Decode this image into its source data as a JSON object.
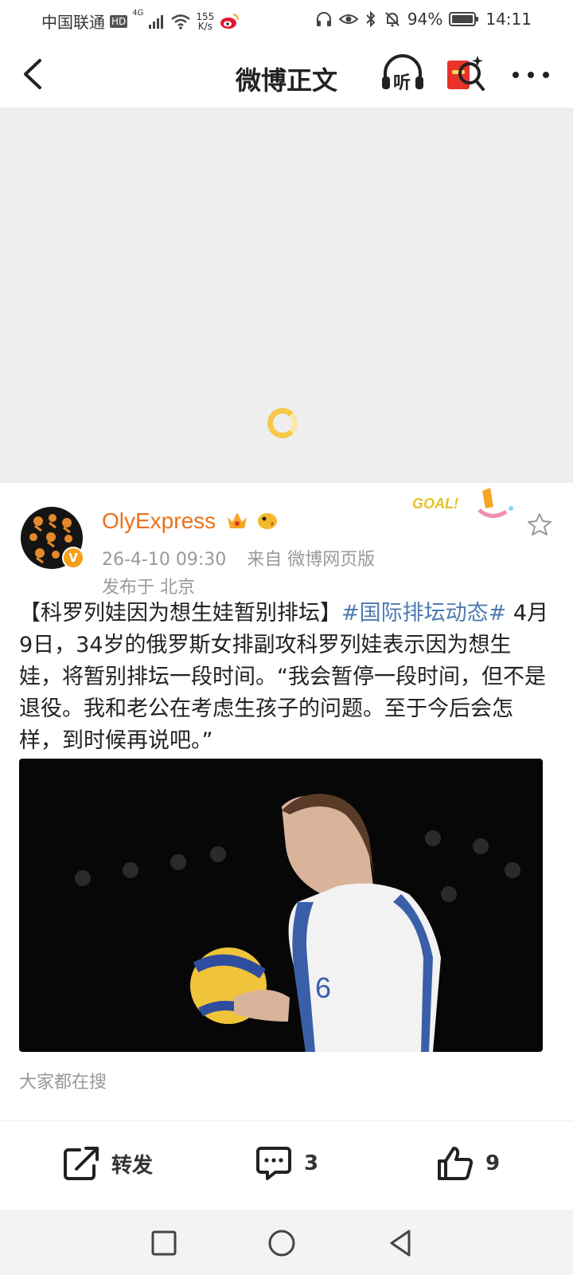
{
  "status_bar": {
    "carrier": "中国联通",
    "hd": "HD",
    "network": "4G",
    "speed_value": "155",
    "speed_unit": "K/s",
    "battery": "94%",
    "time": "14:11"
  },
  "nav": {
    "title": "微博正文",
    "listen_label": "听"
  },
  "post": {
    "username": "OlyExpress",
    "timestamp": "26-4-10 09:30",
    "source": "来自 微博网页版",
    "location": "发布于 北京",
    "goal_badge_text": "GOAL!",
    "text_intro": "【科罗列娃因为想生娃暂别排坛】",
    "hashtag": "#国际排坛动态#",
    "text_body": "4月9日，34岁的俄罗斯女排副攻科罗列娃表示因为想生娃，将暂别排坛一段时间。“我会暂停一段时间，但不是退役。我和老公在考虑生孩子的问题。至于今后会怎样，到时候再说吧。”",
    "jersey_number": "6",
    "search_hint": "大家都在搜"
  },
  "actions": {
    "repost_label": "转发",
    "comment_count": "3",
    "like_count": "9"
  },
  "colors": {
    "username": "#e9711c",
    "hashtag": "#4f7bb2",
    "meta": "#999999",
    "loading": "#f7c947"
  }
}
